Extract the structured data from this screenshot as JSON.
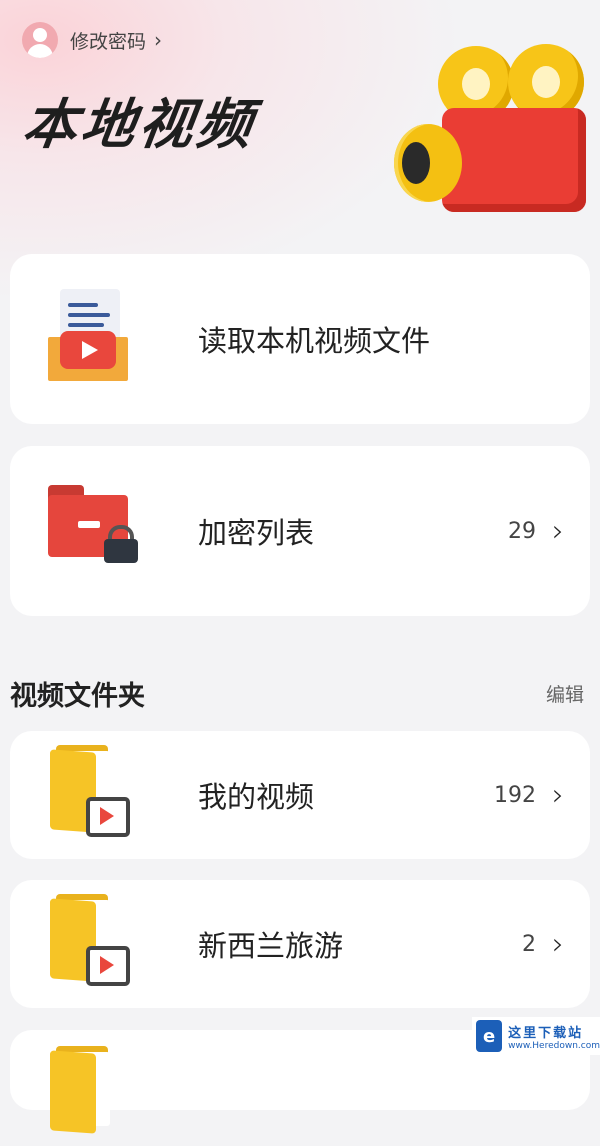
{
  "header": {
    "change_password_label": "修改密码",
    "chevron": ">",
    "page_title": "本地视频"
  },
  "actions": [
    {
      "label": "读取本机视频文件"
    },
    {
      "label": "加密列表",
      "count": "29"
    }
  ],
  "folders_section": {
    "title": "视频文件夹",
    "edit_label": "编辑",
    "items": [
      {
        "name": "我的视频",
        "count": "192"
      },
      {
        "name": "新西兰旅游",
        "count": "2"
      }
    ]
  },
  "watermark": {
    "title": "这里下载站",
    "url": "www.Heredown.com",
    "logo_glyph": "e"
  },
  "colors": {
    "accent_red": "#e9473d",
    "folder_yellow": "#f6c426",
    "watermark_blue": "#1c5fb8"
  }
}
